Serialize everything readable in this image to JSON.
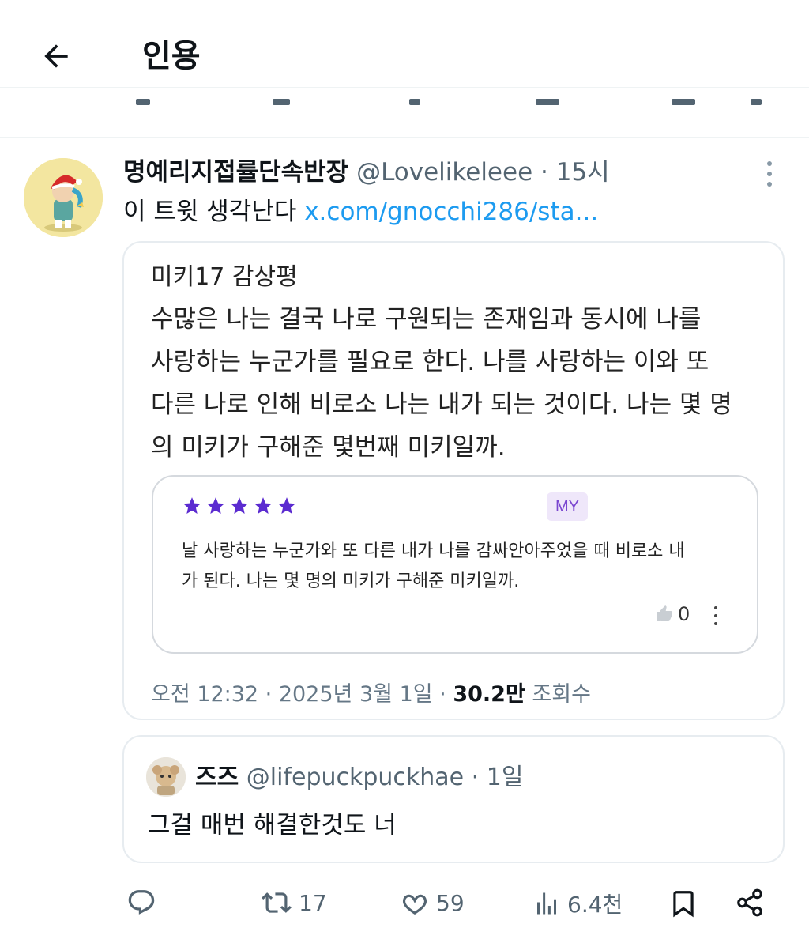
{
  "header": {
    "title": "인용"
  },
  "tweet": {
    "author_name": "명예리지접률단속반장",
    "handle": "@Lovelikeleee",
    "separator": " · ",
    "time": "15시",
    "text": "이 트윗 생각난다 ",
    "link": "x.com/gnocchi286/sta..."
  },
  "media_card": {
    "title": "미키17 감상평",
    "body_lines": [
      "수많은 나는 결국 나로 구원되는 존재임과 동시에 나를",
      "사랑하는 누군가를 필요로 한다. 나를 사랑하는 이와 또",
      "다른 나로 인해 비로소 나는 내가 되는 것이다. 나는 몇 명",
      "의 미키가 구해준 몇번째 미키일까."
    ],
    "review": {
      "stars": 5,
      "star_color": "#5b2bd0",
      "badge": "MY",
      "lines": [
        "날 사랑하는 누군가와 또 다른 내가 나를 감싸안아주었을 때 비로소 내",
        "가 된다. 나는 몇 명의 미키가 구해준 미키일까."
      ],
      "like_count": "0"
    },
    "meta": {
      "time": "오전 12:32",
      "date": "2025년 3월 1일",
      "views": "30.2만",
      "views_label": " 조회수"
    }
  },
  "quote": {
    "name": "즈즈",
    "handle": "@lifepuckpuckhae",
    "time": "1일",
    "text": "그걸 매번 해결한것도 너"
  },
  "actions": {
    "retweets": "17",
    "likes": "59",
    "views": "6.4천"
  },
  "colors": {
    "link": "#1d9bf0",
    "secondary_text": "#536471",
    "border": "#e7ecf0"
  }
}
